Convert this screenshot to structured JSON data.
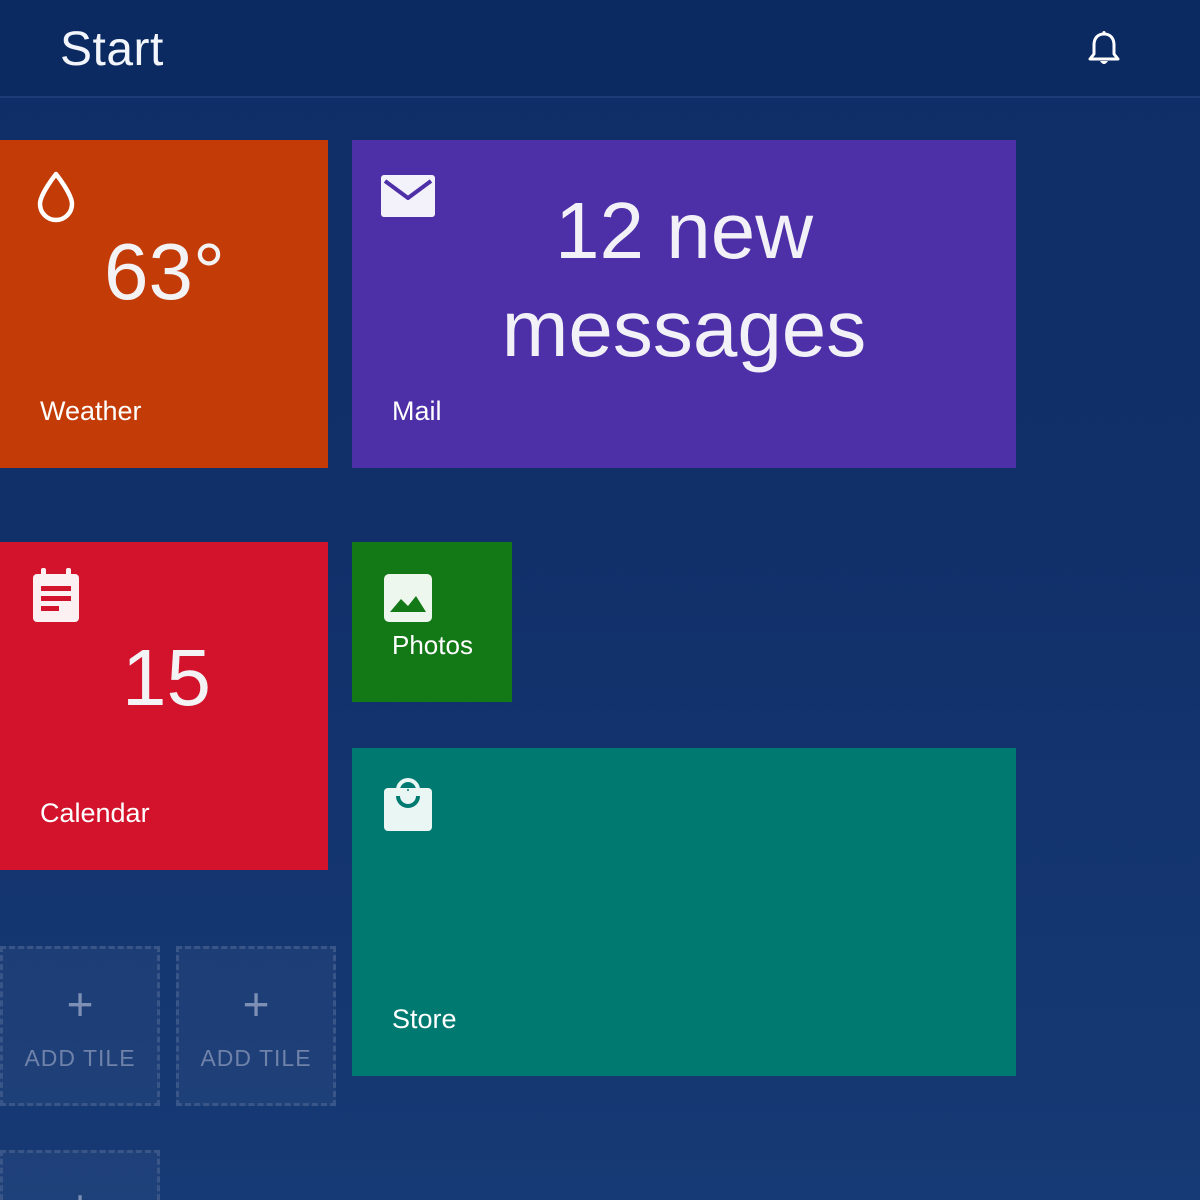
{
  "header": {
    "title": "Start",
    "notification_icon": "bell-icon"
  },
  "tiles": {
    "weather": {
      "label": "Weather",
      "value": "63°",
      "icon": "droplet-icon",
      "color": "#c33b06"
    },
    "mail": {
      "label": "Mail",
      "value": "12 new messages",
      "icon": "envelope-icon",
      "color": "#4d30a7"
    },
    "calendar": {
      "label": "Calendar",
      "value": "15",
      "icon": "calendar-icon",
      "color": "#d3132b"
    },
    "photos": {
      "label": "Photos",
      "icon": "image-icon",
      "color": "#137816"
    },
    "store": {
      "label": "Store",
      "icon": "shopping-bag-icon",
      "color": "#007a70"
    }
  },
  "add_tiles": [
    {
      "label": "ADD TILE",
      "symbol": "+"
    },
    {
      "label": "ADD TILE",
      "symbol": "+"
    },
    {
      "label": "",
      "symbol": "+"
    }
  ],
  "colors": {
    "background": "#11306a",
    "topbar": "#0b2a62"
  }
}
